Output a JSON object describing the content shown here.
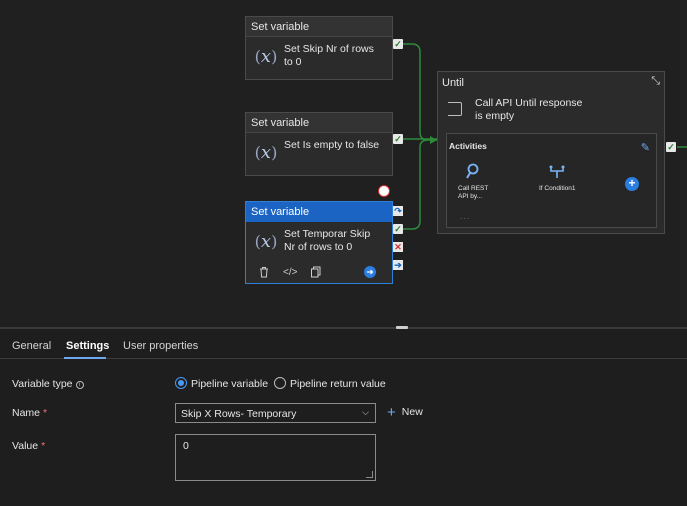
{
  "canvas": {
    "node1": {
      "header": "Set variable",
      "text": "Set Skip Nr of rows to 0"
    },
    "node2": {
      "header": "Set variable",
      "text": "Set Is empty to false"
    },
    "node3": {
      "header": "Set variable",
      "text": "Set Temporar Skip Nr of rows to 0"
    },
    "until": {
      "title": "Until",
      "text": "Call API Until response is empty",
      "activities_label": "Activities",
      "inner": [
        {
          "label": "Call REST API by...",
          "icon": "search-icon"
        },
        {
          "label": "If Condition1",
          "icon": "branch-icon"
        }
      ]
    }
  },
  "tabs": [
    {
      "label": "General"
    },
    {
      "label": "Settings"
    },
    {
      "label": "User properties"
    }
  ],
  "settings": {
    "variable_type_label": "Variable type",
    "radio_pipeline": "Pipeline variable",
    "radio_return": "Pipeline return value",
    "name_label": "Name",
    "name_value": "Skip X Rows- Temporary",
    "new_label": "New",
    "value_label": "Value",
    "value_value": "0"
  },
  "colors": {
    "accent": "#1b64c4",
    "success": "#2e7d32",
    "failure": "#d32f2f"
  }
}
